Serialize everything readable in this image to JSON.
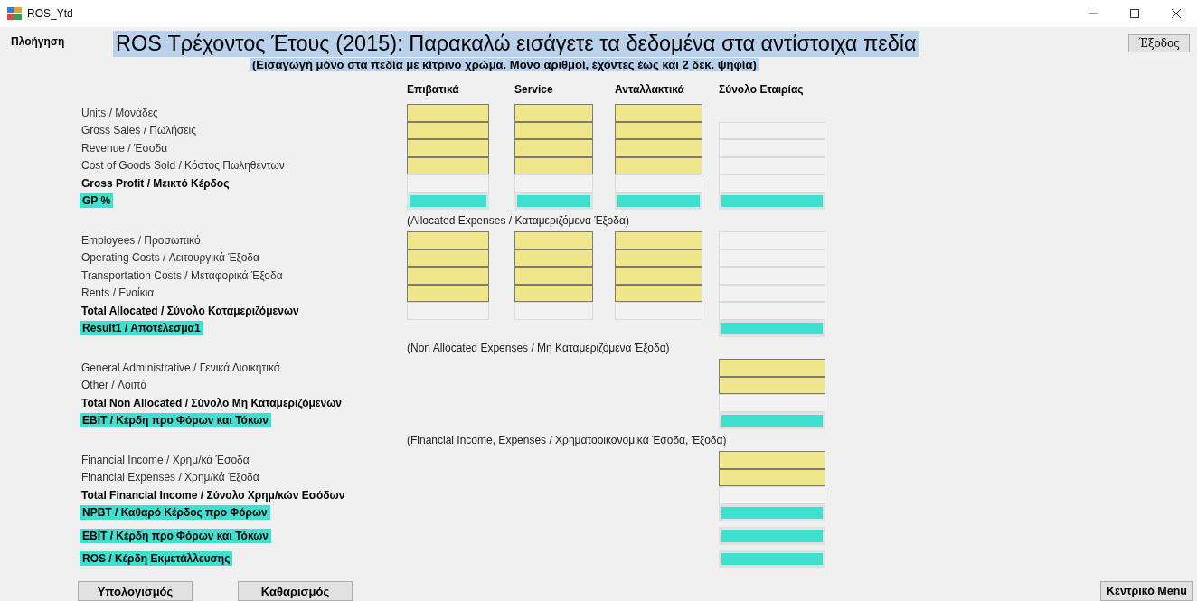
{
  "window": {
    "title": "ROS_Ytd"
  },
  "nav_label": "Πλοήγηση",
  "title": "ROS Τρέχοντος Έτους (2015): Παρακαλώ εισάγετε τα δεδομένα στα αντίστοιχα πεδία",
  "subtitle": "(Εισαγωγή μόνο στα πεδία με κίτρινο χρώμα. Μόνο αριθμοί, έχοντες έως και 2 δεκ. ψηφία)",
  "exit_button": "Έξοδος",
  "columns": [
    "Επιβατικά",
    "Service",
    "Ανταλλακτικά",
    "Σύνολο Εταιρίας"
  ],
  "sections": [
    {
      "rows": [
        {
          "label": "Units / Μονάδες",
          "kind": "normal",
          "cells": [
            {
              "kind": "input"
            },
            {
              "kind": "input"
            },
            {
              "kind": "input"
            },
            {
              "kind": "empty"
            }
          ]
        },
        {
          "label": "Gross Sales / Πωλήσεις",
          "kind": "normal",
          "cells": [
            {
              "kind": "input"
            },
            {
              "kind": "input"
            },
            {
              "kind": "input"
            },
            {
              "kind": "computed"
            }
          ]
        },
        {
          "label": "Revenue / Έσοδα",
          "kind": "normal",
          "cells": [
            {
              "kind": "input"
            },
            {
              "kind": "input"
            },
            {
              "kind": "input"
            },
            {
              "kind": "computed"
            }
          ]
        },
        {
          "label": "Cost of Goods Sold / Κόστος Πωληθέντων",
          "kind": "normal",
          "cells": [
            {
              "kind": "input"
            },
            {
              "kind": "input"
            },
            {
              "kind": "input"
            },
            {
              "kind": "computed"
            }
          ]
        },
        {
          "label": "Gross Profit / Μεικτό Κέρδος",
          "kind": "bold",
          "cells": [
            {
              "kind": "computed"
            },
            {
              "kind": "computed"
            },
            {
              "kind": "computed"
            },
            {
              "kind": "computed"
            }
          ]
        },
        {
          "label": "GP %",
          "kind": "highlight",
          "cells": [
            {
              "kind": "result"
            },
            {
              "kind": "result"
            },
            {
              "kind": "result"
            },
            {
              "kind": "result"
            }
          ]
        }
      ]
    },
    {
      "note": "(Allocated Expenses / Καταμεριζόμενα Έξοδα)",
      "rows": [
        {
          "label": "Employees / Προσωπικό",
          "kind": "normal",
          "cells": [
            {
              "kind": "input"
            },
            {
              "kind": "input"
            },
            {
              "kind": "input"
            },
            {
              "kind": "computed"
            }
          ]
        },
        {
          "label": "Operating Costs / Λειτουργικά Έξοδα",
          "kind": "normal",
          "cells": [
            {
              "kind": "input"
            },
            {
              "kind": "input"
            },
            {
              "kind": "input"
            },
            {
              "kind": "computed"
            }
          ]
        },
        {
          "label": "Transportation Costs / Μεταφορικά Έξοδα",
          "kind": "normal",
          "cells": [
            {
              "kind": "input"
            },
            {
              "kind": "input"
            },
            {
              "kind": "input"
            },
            {
              "kind": "computed"
            }
          ]
        },
        {
          "label": "Rents / Ενοίκια",
          "kind": "normal",
          "cells": [
            {
              "kind": "input"
            },
            {
              "kind": "input"
            },
            {
              "kind": "input"
            },
            {
              "kind": "computed"
            }
          ]
        },
        {
          "label": "Total Allocated / Σύνολο Καταμεριζόμενων",
          "kind": "bold",
          "cells": [
            {
              "kind": "computed"
            },
            {
              "kind": "computed"
            },
            {
              "kind": "computed"
            },
            {
              "kind": "computed"
            }
          ]
        },
        {
          "label": "Result1 / Αποτέλεσμα1",
          "kind": "highlight",
          "cells": [
            {
              "kind": "empty"
            },
            {
              "kind": "empty"
            },
            {
              "kind": "empty"
            },
            {
              "kind": "result"
            }
          ]
        }
      ]
    },
    {
      "note": "(Non Allocated Expenses / Μη Καταμεριζόμενα Έξοδα)",
      "rows": [
        {
          "label": "General Administrative / Γενικά Διοικητικά",
          "kind": "normal",
          "cells": [
            {
              "kind": "empty"
            },
            {
              "kind": "empty"
            },
            {
              "kind": "empty"
            },
            {
              "kind": "input"
            }
          ]
        },
        {
          "label": "Other / Λοιπά",
          "kind": "normal",
          "cells": [
            {
              "kind": "empty"
            },
            {
              "kind": "empty"
            },
            {
              "kind": "empty"
            },
            {
              "kind": "input"
            }
          ]
        },
        {
          "label": "Total Non Allocated / Σύνολο Μη Καταμεριζόμενων",
          "kind": "bold",
          "cells": [
            {
              "kind": "empty"
            },
            {
              "kind": "empty"
            },
            {
              "kind": "empty"
            },
            {
              "kind": "computed"
            }
          ]
        },
        {
          "label": "EBIT / Κέρδη προ Φόρων και Τόκων",
          "kind": "highlight",
          "cells": [
            {
              "kind": "empty"
            },
            {
              "kind": "empty"
            },
            {
              "kind": "empty"
            },
            {
              "kind": "result"
            }
          ]
        }
      ]
    },
    {
      "note": "(Financial Income, Expenses / Χρηματοοικονομικά Έσοδα, Έξοδα)",
      "rows": [
        {
          "label": "Financial Income / Χρημ/κά Έσοδα",
          "kind": "normal",
          "cells": [
            {
              "kind": "empty"
            },
            {
              "kind": "empty"
            },
            {
              "kind": "empty"
            },
            {
              "kind": "input"
            }
          ]
        },
        {
          "label": "Financial Expenses / Χρημ/κά Έξοδα",
          "kind": "normal",
          "cells": [
            {
              "kind": "empty"
            },
            {
              "kind": "empty"
            },
            {
              "kind": "empty"
            },
            {
              "kind": "input"
            }
          ]
        },
        {
          "label": "Total Financial Income / Σύνολο Χρημ/κών Εσόδων",
          "kind": "bold",
          "cells": [
            {
              "kind": "empty"
            },
            {
              "kind": "empty"
            },
            {
              "kind": "empty"
            },
            {
              "kind": "computed"
            }
          ]
        },
        {
          "label": "NPBT / Καθαρό Κέρδος προ Φόρων",
          "kind": "highlight",
          "cells": [
            {
              "kind": "empty"
            },
            {
              "kind": "empty"
            },
            {
              "kind": "empty"
            },
            {
              "kind": "result"
            }
          ]
        }
      ]
    },
    {
      "rows": [
        {
          "label": "EBIT / Κέρδη προ Φόρων και Τόκων",
          "kind": "highlight",
          "cells": [
            {
              "kind": "empty"
            },
            {
              "kind": "empty"
            },
            {
              "kind": "empty"
            },
            {
              "kind": "result"
            }
          ]
        }
      ]
    },
    {
      "rows": [
        {
          "label": "ROS / Κέρδη Εκμετάλλευσης",
          "kind": "highlight",
          "cells": [
            {
              "kind": "empty"
            },
            {
              "kind": "empty"
            },
            {
              "kind": "empty"
            },
            {
              "kind": "result"
            }
          ]
        }
      ]
    }
  ],
  "buttons": [
    "Υπολογισμός",
    "Καθαρισμός"
  ],
  "main_menu_button": "Κεντρικό Menu"
}
